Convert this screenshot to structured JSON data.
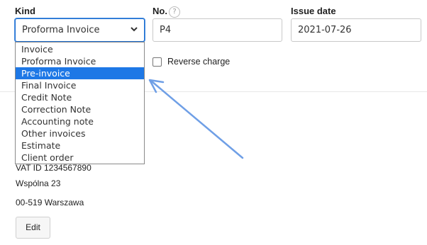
{
  "form": {
    "kind_label": "Kind",
    "kind_value": "Proforma Invoice",
    "no_label": "No.",
    "no_help": "?",
    "no_value": "P4",
    "issue_date_label": "Issue date",
    "issue_date_value": "2021-07-26",
    "reverse_charge_label": "Reverse charge",
    "reverse_charge_checked": false
  },
  "dropdown": {
    "options": [
      "Invoice",
      "Proforma Invoice",
      "Pre-invoice",
      "Final Invoice",
      "Credit Note",
      "Correction Note",
      "Accounting note",
      "Other invoices",
      "Estimate",
      "Client order"
    ],
    "highlighted_index": 2
  },
  "seller": {
    "vat_id": "VAT ID 1234567890",
    "street": "Wspólna 23",
    "city": "00-519 Warszawa",
    "edit_label": "Edit"
  },
  "colors": {
    "highlight": "#1e78e6",
    "arrow": "#6f9fe6",
    "focus_border": "#1f6fd1"
  }
}
